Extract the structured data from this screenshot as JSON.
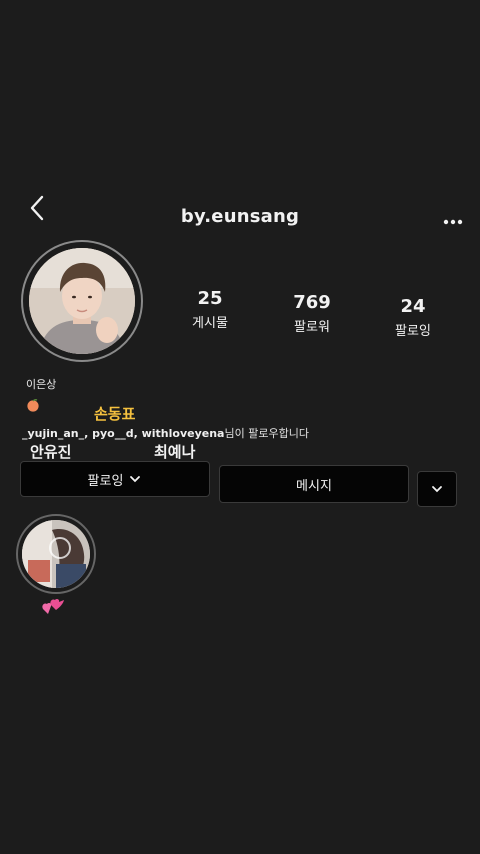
{
  "header": {
    "username": "by.eunsang",
    "back_icon": "chevron-left-icon",
    "more_icon": "more-horizontal-icon"
  },
  "profile": {
    "avatar_icon": "profile-photo",
    "stats": [
      {
        "value": "25",
        "label": "게시물"
      },
      {
        "value": "769",
        "label": "팔로워"
      },
      {
        "value": "24",
        "label": "팔로잉"
      }
    ],
    "display_name": "이은상",
    "bio_emoji": "peach-emoji",
    "followed_by": {
      "users": "_yujin_an_, pyo__d, withloveyena",
      "suffix": "님이 팔로우합니다"
    }
  },
  "overlays": {
    "label_1": "손동표",
    "label_1_color": "#f5c13f",
    "label_2": "안유진",
    "label_3": "최예나"
  },
  "actions": {
    "following_label": "팔로잉",
    "message_label": "메시지",
    "dropdown_icon": "chevron-down-icon"
  },
  "highlights": [
    {
      "icon": "highlight-cover",
      "label_emoji": "two-hearts-emoji"
    }
  ],
  "colors": {
    "background": "#1c1c1c",
    "button": "#050505",
    "text": "#f2f2f2"
  }
}
